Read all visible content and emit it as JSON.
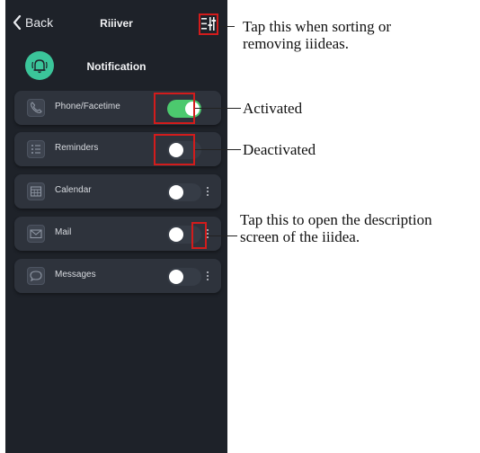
{
  "colors": {
    "screen_bg": "#1e2229",
    "card_bg": "#2e333c",
    "toggle_on": "#4cc96e",
    "toggle_off": "#363c46",
    "header_icon_bg": "#3bc59a",
    "highlight": "#d21c1c"
  },
  "topbar": {
    "back_label": "Back",
    "app_title": "Riiiver",
    "sort_icon": "sort-remove-icon"
  },
  "header": {
    "icon": "bell-icon",
    "title": "Notification"
  },
  "items": [
    {
      "label": "Phone/Facetime",
      "icon": "phone-icon",
      "enabled": true
    },
    {
      "label": "Reminders",
      "icon": "list-icon",
      "enabled": false
    },
    {
      "label": "Calendar",
      "icon": "calendar-icon",
      "enabled": false
    },
    {
      "label": "Mail",
      "icon": "mail-icon",
      "enabled": false
    },
    {
      "label": "Messages",
      "icon": "message-icon",
      "enabled": false
    }
  ],
  "annotations": {
    "sort": {
      "line1": "Tap this when sorting or",
      "line2": "removing iiideas."
    },
    "activated": "Activated",
    "deactivated": "Deactivated",
    "description": {
      "line1": "Tap this to open the description",
      "line2": "screen of the iiidea."
    }
  }
}
